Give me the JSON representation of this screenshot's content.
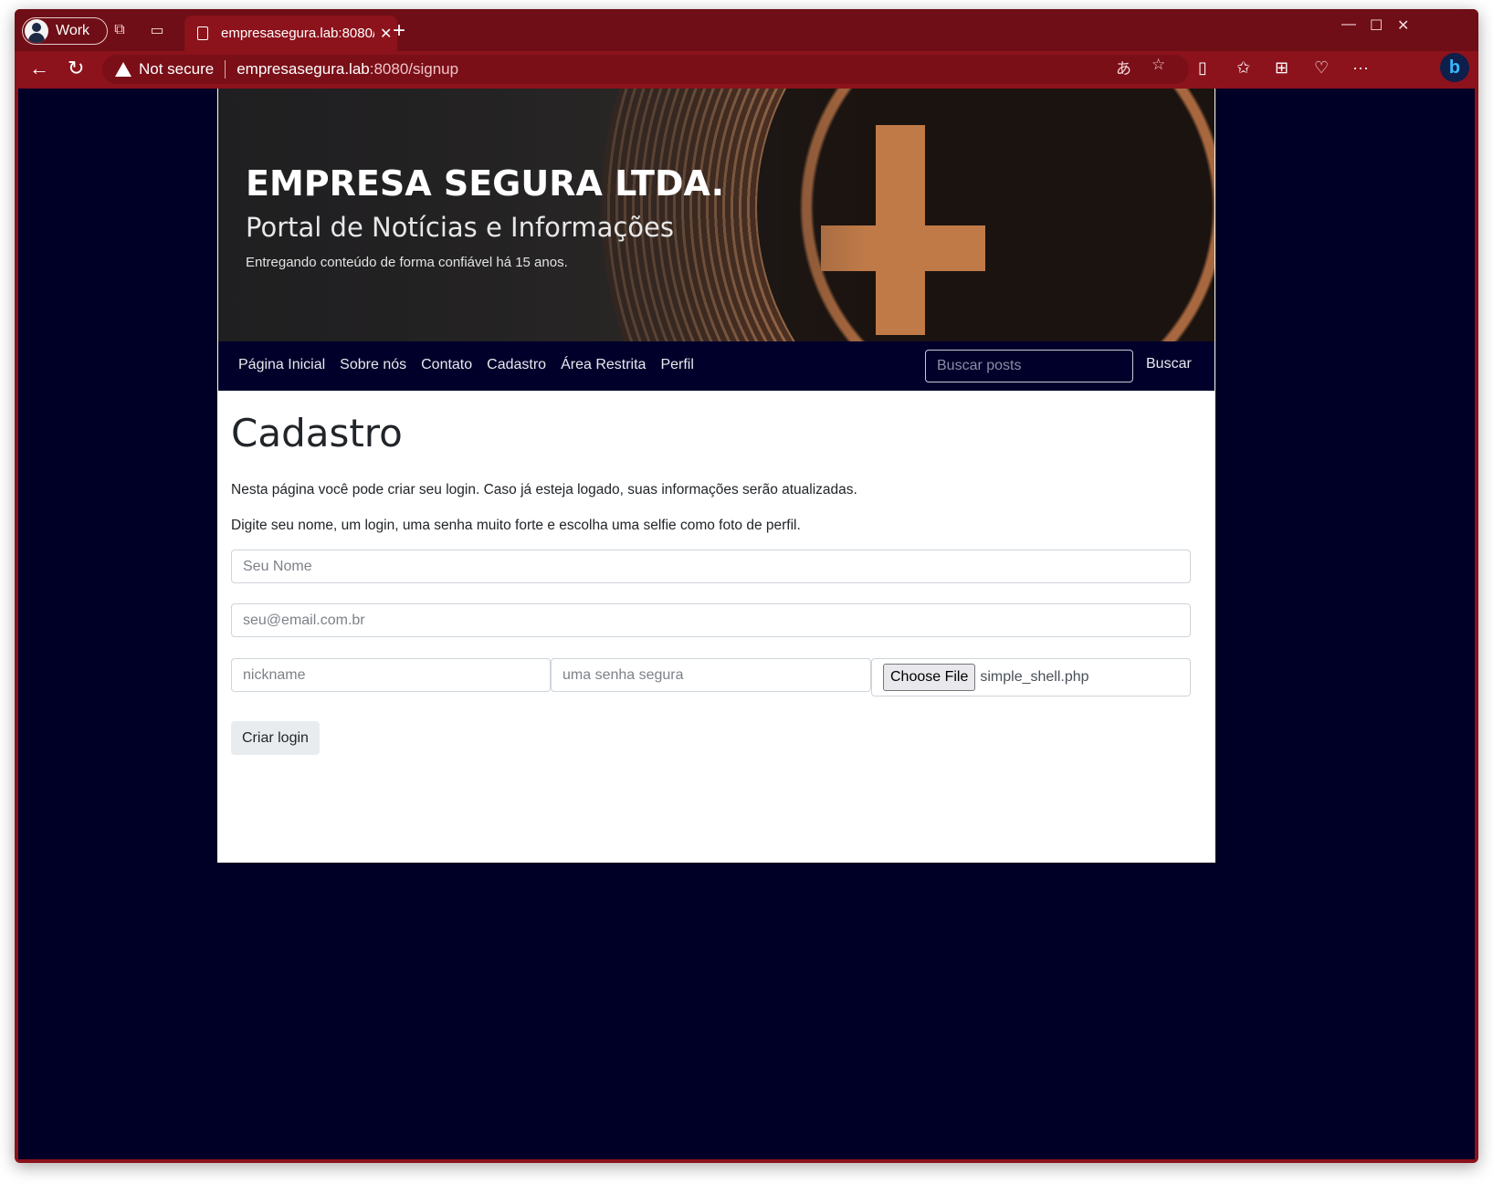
{
  "browser": {
    "profile_label": "Work",
    "tab_title": "empresasegura.lab:8080/",
    "security_label": "Not secure",
    "url_host": "empresasegura.lab",
    "url_rest": ":8080/signup",
    "accent_color": "#8c121c"
  },
  "site": {
    "title": "EMPRESA SEGURA LTDA.",
    "subtitle": "Portal de Notícias e Informações",
    "tagline": "Entregando conteúdo de forma confiável há 15 anos.",
    "nav": [
      "Página Inicial",
      "Sobre nós",
      "Contato",
      "Cadastro",
      "Área Restrita",
      "Perfil"
    ],
    "search_placeholder": "Buscar posts",
    "search_button": "Buscar",
    "navbar_color": "#00002a"
  },
  "signup": {
    "heading": "Cadastro",
    "intro": "Nesta página você pode criar seu login. Caso já esteja logado, suas informações serão atualizadas.",
    "instructions": "Digite seu nome, um login, uma senha muito forte e escolha uma selfie como foto de perfil.",
    "name_placeholder": "Seu Nome",
    "email_placeholder": "seu@email.com.br",
    "nickname_placeholder": "nickname",
    "password_placeholder": "uma senha segura",
    "file_button": "Choose File",
    "file_name": "simple_shell.php",
    "submit_label": "Criar login"
  }
}
